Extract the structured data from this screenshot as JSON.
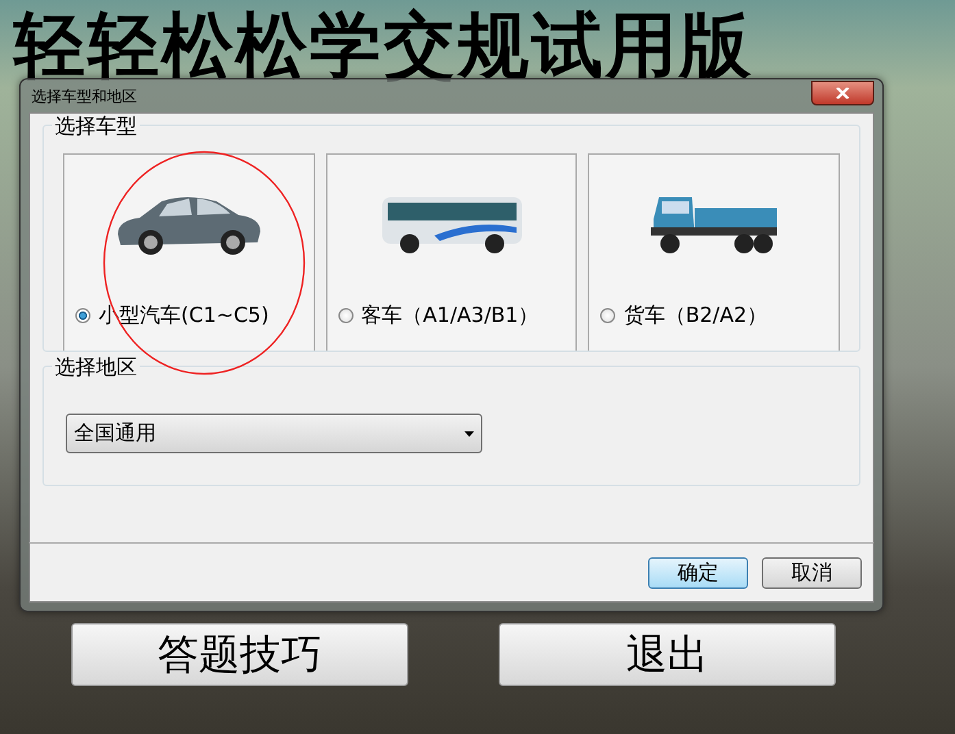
{
  "app_title": "轻轻松松学交规试用版",
  "dialog": {
    "title": "选择车型和地区",
    "vehicle_group": {
      "label": "选择车型",
      "vehicles": [
        {
          "kind": "car",
          "label": "小型汽车(C1~C5)",
          "selected": true
        },
        {
          "kind": "bus",
          "label": "客车（A1/A3/B1）",
          "selected": false
        },
        {
          "kind": "truck",
          "label": "货车（B2/A2）",
          "selected": false
        }
      ]
    },
    "region_group": {
      "label": "选择地区",
      "value": "全国通用"
    },
    "buttons": [
      {
        "label": "确定",
        "kind": "primary"
      },
      {
        "label": "取消",
        "kind": "default"
      }
    ]
  },
  "bottom_buttons": [
    "答题技巧",
    "退出"
  ]
}
